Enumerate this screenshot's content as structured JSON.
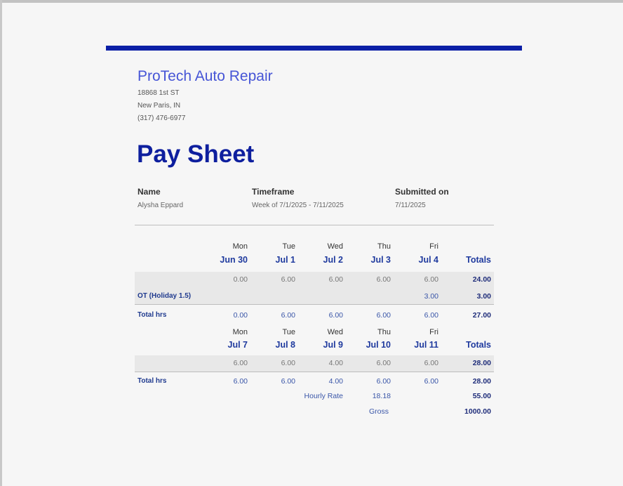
{
  "company": {
    "name": "ProTech Auto Repair",
    "address1": "18868 1st ST",
    "address2": "New Paris, IN",
    "phone": "(317) 476-6977"
  },
  "title": "Pay Sheet",
  "info": {
    "name_label": "Name",
    "name_value": "Alysha Eppard",
    "timeframe_label": "Timeframe",
    "timeframe_value": "Week of 7/1/2025 - 7/11/2025",
    "submitted_label": "Submitted on",
    "submitted_value": "7/11/2025"
  },
  "week1": {
    "days": [
      "Mon",
      "Tue",
      "Wed",
      "Thu",
      "Fri"
    ],
    "dates": [
      "Jun 30",
      "Jul 1",
      "Jul 2",
      "Jul 3",
      "Jul 4"
    ],
    "totals_label": "Totals",
    "regular": [
      "0.00",
      "6.00",
      "6.00",
      "6.00",
      "6.00"
    ],
    "regular_total": "24.00",
    "ot_label": "OT (Holiday 1.5)",
    "ot_fri": "3.00",
    "ot_total": "3.00",
    "total_label": "Total hrs",
    "total": [
      "0.00",
      "6.00",
      "6.00",
      "6.00",
      "6.00"
    ],
    "total_total": "27.00"
  },
  "week2": {
    "days": [
      "Mon",
      "Tue",
      "Wed",
      "Thu",
      "Fri"
    ],
    "dates": [
      "Jul 7",
      "Jul 8",
      "Jul 9",
      "Jul 10",
      "Jul 11"
    ],
    "totals_label": "Totals",
    "regular": [
      "6.00",
      "6.00",
      "4.00",
      "6.00",
      "6.00"
    ],
    "regular_total": "28.00",
    "total_label": "Total hrs",
    "total": [
      "6.00",
      "6.00",
      "4.00",
      "6.00",
      "6.00"
    ],
    "total_total": "28.00"
  },
  "summary": {
    "hourly_rate_label": "Hourly Rate",
    "hourly_rate_value": "18.18",
    "hours_total": "55.00",
    "gross_label": "Gross",
    "gross_value": "1000.00"
  },
  "colors": {
    "accent_bar": "#0b1fa6",
    "title": "#0e1f9e",
    "company": "#4655d6"
  }
}
